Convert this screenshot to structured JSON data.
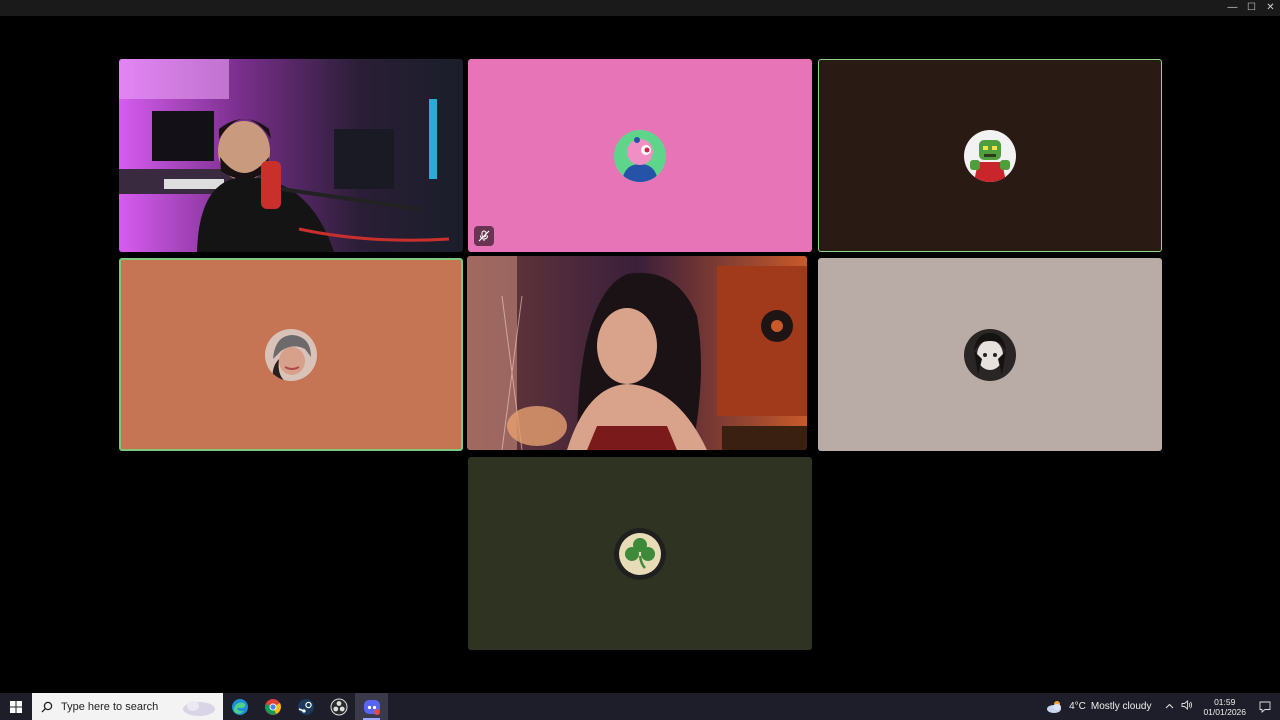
{
  "window": {
    "controls": {
      "minimize": "—",
      "maximize": "☐",
      "close": "✕"
    }
  },
  "tiles": [
    {
      "name": "video-tile-1",
      "type": "video",
      "bg": "#2a1630"
    },
    {
      "name": "avatar-tile-2",
      "type": "avatar",
      "bg": "#e774b7",
      "muted": true,
      "avatar": "pink-bird-avatar"
    },
    {
      "name": "avatar-tile-3",
      "type": "avatar",
      "bg": "#2a1a14",
      "speaking": true,
      "avatar": "green-robot-avatar"
    },
    {
      "name": "avatar-tile-4",
      "type": "avatar",
      "bg": "#c57553",
      "speaking": true,
      "avatar": "person-photo-avatar"
    },
    {
      "name": "video-tile-5",
      "type": "video",
      "bg": "#3a1a1a"
    },
    {
      "name": "avatar-tile-6",
      "type": "avatar",
      "bg": "#b9aba6",
      "avatar": "dark-portrait-avatar"
    },
    {
      "name": "avatar-tile-7",
      "type": "avatar",
      "bg": "#2e3421",
      "avatar": "shamrock-avatar"
    }
  ],
  "taskbar": {
    "search_placeholder": "Type here to search",
    "pinned": [
      "edge-icon",
      "chrome-icon",
      "steam-icon",
      "obs-icon",
      "discord-icon"
    ],
    "active_app": "discord-icon",
    "weather": {
      "temp": "4°C",
      "condition": "Mostly cloudy"
    },
    "time": "01:59",
    "date": "01/01/2026"
  }
}
